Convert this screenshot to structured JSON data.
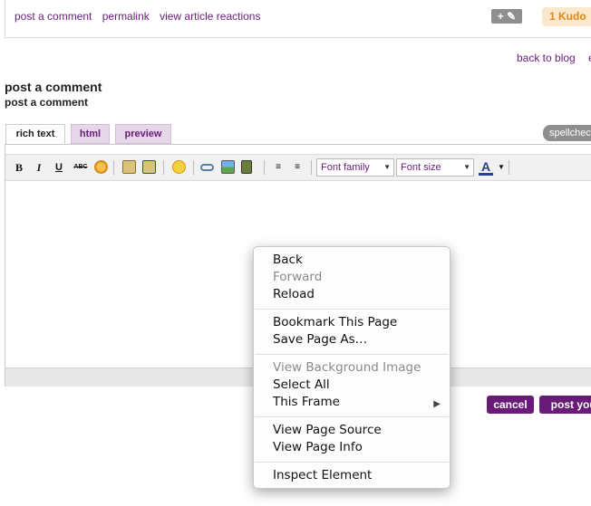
{
  "footer": {
    "links": [
      "post a comment",
      "permalink",
      "view article reactions"
    ],
    "tag_button": "+ ✎",
    "kudo_label": "1 Kudo"
  },
  "nav": {
    "back_to_blog": "back to blog",
    "next": "e"
  },
  "comment": {
    "title": "post a comment",
    "subtitle": "post a comment"
  },
  "tabs": [
    {
      "label": "rich text",
      "active": true
    },
    {
      "label": "html",
      "active": false
    },
    {
      "label": "preview",
      "active": false
    }
  ],
  "spellcheck_label": "spellcheck",
  "toolbar": {
    "bold": "B",
    "italic": "I",
    "underline": "U",
    "strike": "ABC",
    "font_family": "Font family",
    "font_size": "Font size",
    "text_color": "A"
  },
  "buttons": {
    "cancel": "cancel",
    "post": "post your"
  },
  "context_menu": {
    "groups": [
      [
        {
          "label": "Back",
          "disabled": false
        },
        {
          "label": "Forward",
          "disabled": true
        },
        {
          "label": "Reload",
          "disabled": false
        }
      ],
      [
        {
          "label": "Bookmark This Page",
          "disabled": false
        },
        {
          "label": "Save Page As…",
          "disabled": false
        }
      ],
      [
        {
          "label": "View Background Image",
          "disabled": true
        },
        {
          "label": "Select All",
          "disabled": false
        },
        {
          "label": "This Frame",
          "disabled": false,
          "submenu": true
        }
      ],
      [
        {
          "label": "View Page Source",
          "disabled": false
        },
        {
          "label": "View Page Info",
          "disabled": false
        }
      ],
      [
        {
          "label": "Inspect Element",
          "disabled": false
        }
      ]
    ]
  },
  "colors": {
    "accent": "#6a1b7a",
    "kudo_bg": "#fbe8cc",
    "kudo_text": "#d98a1e",
    "tab_inactive": "#e6d6ea"
  }
}
